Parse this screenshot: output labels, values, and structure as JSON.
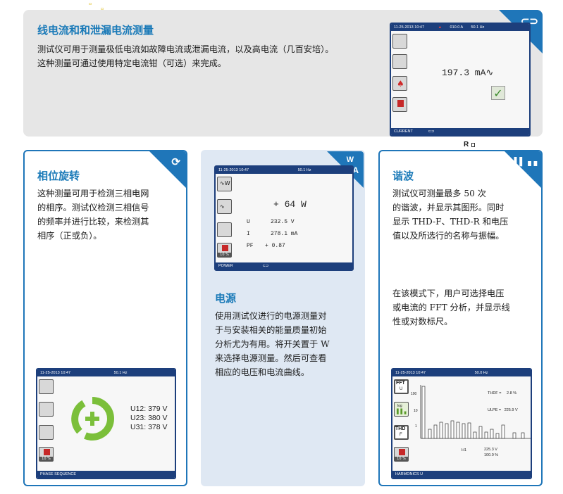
{
  "top_section": {
    "title": "线电流和和泄漏电流测量",
    "desc_line1": "测试仪可用于测量极低电流如故障电流或泄漏电流，以及高电流（几百安培）。",
    "desc_line2": "这种测量可通过使用特定电流钳（可选）来完成。",
    "screen": {
      "datetime": "11-25-2013 10:47",
      "reading_top": "010.0 A",
      "freq": "50.1 Hz",
      "value": "197.3 mA∿",
      "mode": "CURRENT"
    }
  },
  "r_mark": "R",
  "phase_card": {
    "title": "相位旋转",
    "desc": [
      "这种测量可用于检测三相电网",
      "的相序。测试仪检测三相信号",
      "的频率并进行比较，来检测其",
      "相序（正或负）。"
    ],
    "screen": {
      "datetime": "11-25-2013 10:47",
      "freq": "50.1 Hz",
      "u12": "U12: 379 V",
      "u23": "U23: 380 V",
      "u31": "U31: 378 V",
      "percent": "10 %",
      "mode": "PHASE SEQUENCE"
    }
  },
  "power_card": {
    "corner_label": "W",
    "title": "电源",
    "desc": [
      "使用测试仪进行的电源测量对",
      "于与安装相关的能量质量初始",
      "分析尤为有用。将开关置于 W",
      "来选择电源测量。然后可查看",
      "相应的电压和电流曲线。"
    ],
    "screen": {
      "datetime": "11-25-2013 10:47",
      "freq": "50.1 Hz",
      "power": "+ 64 W",
      "u_label": "U",
      "u_value": "232.5 V",
      "i_label": "I",
      "i_value": "278.1 mA",
      "pf_label": "PF",
      "pf_value": "+ 0.87",
      "percent": "10 %",
      "mode": "POWER"
    }
  },
  "harm_card": {
    "title": "谐波",
    "desc1": [
      "测试仪可测量最多 50 次",
      "的谐波，并显示其图形。同时",
      "显示 THD-F、THD-R 和电压",
      "值以及所选行的名称与振幅。"
    ],
    "desc2": [
      "在该模式下，用户可选择电压",
      "或电流的 FFT 分析，并显示线",
      "性或对数标尺。"
    ],
    "screen": {
      "datetime": "11-25-2013 10:47",
      "freq": "50.0 Hz",
      "thdf": "THDF =     2.8 %",
      "ulpe": "ULPE =   225.9 V",
      "btn_fft": "FFT",
      "btn_fft_sub": "U",
      "btn_log": "log",
      "btn_thd": "THD",
      "btn_thd_sub": "F",
      "percent": "10 %",
      "h_label": "H1",
      "h_value1": "225.3 V",
      "h_value2": "100.0 %",
      "y_ticks": [
        "100",
        "10",
        "1"
      ],
      "mode": "HARMONICS U"
    }
  },
  "colors": {
    "accent": "#1f76b9",
    "dark_bar": "#1d3f7c",
    "panel_gray": "#e6e6e6",
    "panel_blue": "#dfe8f3"
  }
}
